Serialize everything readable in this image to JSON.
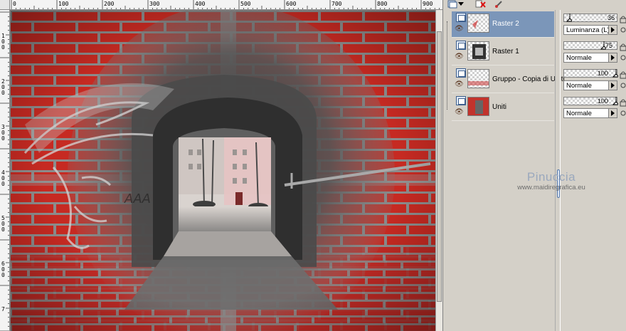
{
  "ruler": {
    "top_labels": [
      "0",
      "100",
      "200",
      "300",
      "400",
      "500",
      "600",
      "700",
      "800",
      "900"
    ],
    "left_labels": [
      "1",
      "0",
      "0",
      "2",
      "0",
      "0",
      "3",
      "0",
      "0",
      "4",
      "0",
      "0",
      "5",
      "0",
      "0",
      "6",
      "0",
      "0",
      "7"
    ]
  },
  "canvas": {
    "description_icon": "brick-wall-tunnel-image"
  },
  "layers_toolbar": {
    "icons": [
      "layer-stack-icon",
      "dropdown-arrow-icon",
      "delete-layer-icon",
      "edit-brush-icon"
    ]
  },
  "layers": [
    {
      "name": "Raster 2",
      "selected": true,
      "opacity": "36",
      "blend_mode": "Luminanza (L)"
    },
    {
      "name": "Raster 1",
      "selected": false,
      "opacity": "75",
      "blend_mode": "Normale"
    },
    {
      "name": "Gruppo - Copia di Uniti",
      "selected": false,
      "opacity": "100",
      "blend_mode": "Normale"
    },
    {
      "name": "Uniti",
      "selected": false,
      "opacity": "100",
      "blend_mode": "Normale"
    }
  ],
  "watermark": {
    "brand": "Pinuccia",
    "url": "www.maidiregrafica.eu"
  },
  "colors": {
    "selected_row": "#7b96b9",
    "brick_red": "#c8231e",
    "panel_bg": "#d4d0c8"
  }
}
